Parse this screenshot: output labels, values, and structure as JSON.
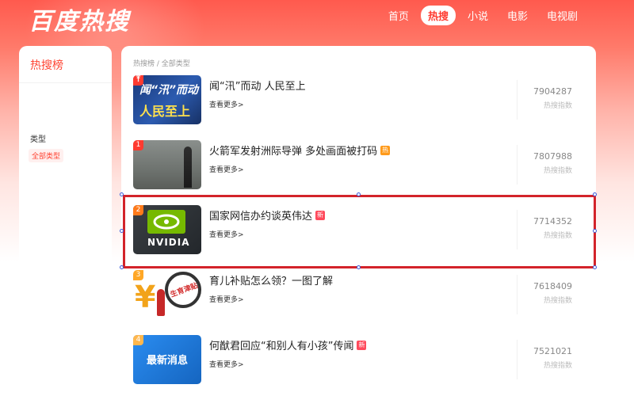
{
  "brand": {
    "logo_text": "百度热搜"
  },
  "nav": {
    "items": [
      {
        "label": "首页",
        "active": false
      },
      {
        "label": "热搜",
        "active": true
      },
      {
        "label": "小说",
        "active": false
      },
      {
        "label": "电影",
        "active": false
      },
      {
        "label": "电视剧",
        "active": false
      }
    ]
  },
  "sidebar": {
    "title": "热搜榜",
    "section_label": "类型",
    "selected_type": "全部类型"
  },
  "main": {
    "breadcrumb": "热搜榜 / 全部类型",
    "more_label": "查看更多>",
    "score_label": "热搜指数",
    "items": [
      {
        "rank": "",
        "rank_icon": "pin-icon",
        "title": "闻“汛”而动 人民至上",
        "badge": "",
        "score": "7904287",
        "thumb_text_1": "闻“汛”而动",
        "thumb_text_2": "人民至上"
      },
      {
        "rank": "1",
        "title": "火箭军发射洲际导弹 多处画面被打码",
        "badge": "热",
        "score": "7807988"
      },
      {
        "rank": "2",
        "title": "国家网信办约谈英伟达",
        "badge": "新",
        "score": "7714352",
        "thumb_text_1": "NVIDIA"
      },
      {
        "rank": "3",
        "title": "育儿补贴怎么领？一图了解",
        "badge": "",
        "score": "7618409",
        "thumb_text_1": "¥",
        "thumb_text_2": "生育津贴"
      },
      {
        "rank": "4",
        "title": "何猷君回应“和别人有小孩”传闻",
        "badge": "新",
        "score": "7521021",
        "thumb_text_1": "最新消息"
      }
    ]
  },
  "colors": {
    "brand_red": "#ff4433",
    "rank_top": "#ff3b30",
    "rank_2": "#ff7a1a",
    "rank_3": "#ffa726",
    "rank_other": "#ffb74d",
    "selection": "#d3232a"
  }
}
